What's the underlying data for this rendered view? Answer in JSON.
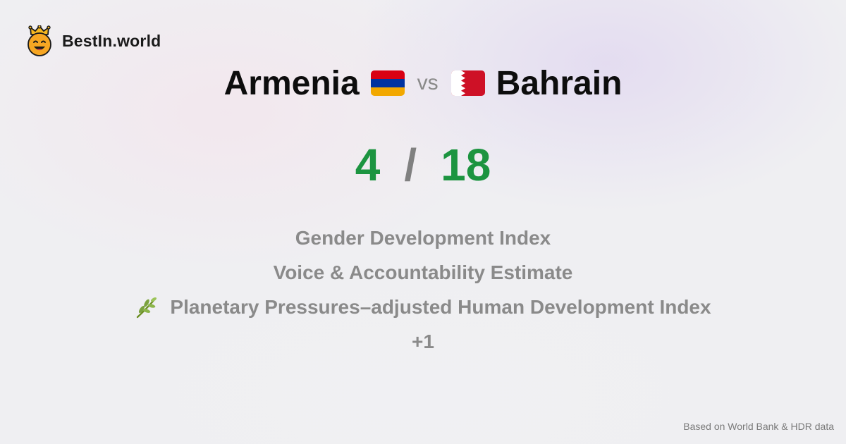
{
  "brand": {
    "name": "BestIn.world",
    "logo_icon": "crowned-smiley-icon"
  },
  "comparison": {
    "country_a": {
      "name": "Armenia",
      "flag_icon": "armenia-flag-icon",
      "score": "4"
    },
    "vs_label": "vs",
    "country_b": {
      "name": "Bahrain",
      "flag_icon": "bahrain-flag-icon",
      "score": "18"
    },
    "score_separator": "/"
  },
  "metrics": [
    {
      "label": "Gender Development Index"
    },
    {
      "label": "Voice & Accountability Estimate"
    },
    {
      "label": "Planetary Pressures–adjusted Human Development Index",
      "icon": "herb-icon"
    }
  ],
  "more_count": "+1",
  "footer": {
    "source_note": "Based on World Bank & HDR data"
  },
  "colors": {
    "score_green": "#1c9440",
    "muted_gray": "#8a8a8a",
    "armenia_red": "#d90012",
    "armenia_blue": "#0033a0",
    "armenia_orange": "#f2a800",
    "bahrain_red": "#ce1126"
  }
}
